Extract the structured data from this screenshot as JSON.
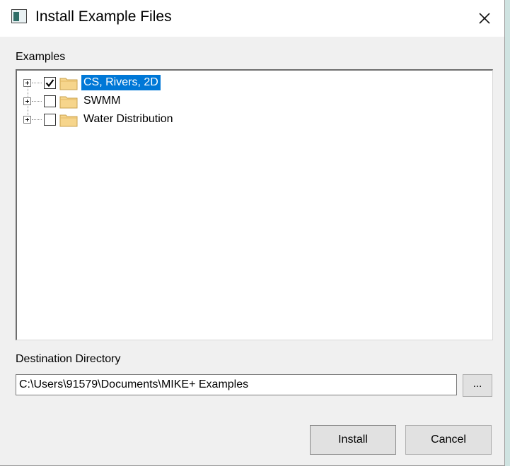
{
  "window": {
    "title": "Install Example Files",
    "icon": "app-window-icon",
    "close_icon": "close-icon"
  },
  "examples": {
    "label": "Examples",
    "items": [
      {
        "label": "CS, Rivers, 2D",
        "checked": true,
        "selected": true,
        "expanded": false,
        "icon": "folder-icon"
      },
      {
        "label": "SWMM",
        "checked": false,
        "selected": false,
        "expanded": false,
        "icon": "folder-icon"
      },
      {
        "label": "Water Distribution",
        "checked": false,
        "selected": false,
        "expanded": false,
        "icon": "folder-icon"
      }
    ]
  },
  "destination": {
    "label": "Destination Directory",
    "value": "C:\\Users\\91579\\Documents\\MIKE+ Examples",
    "browse_label": "..."
  },
  "buttons": {
    "install": "Install",
    "cancel": "Cancel"
  },
  "colors": {
    "selection": "#0078d7",
    "folder": "#f6d58c"
  }
}
